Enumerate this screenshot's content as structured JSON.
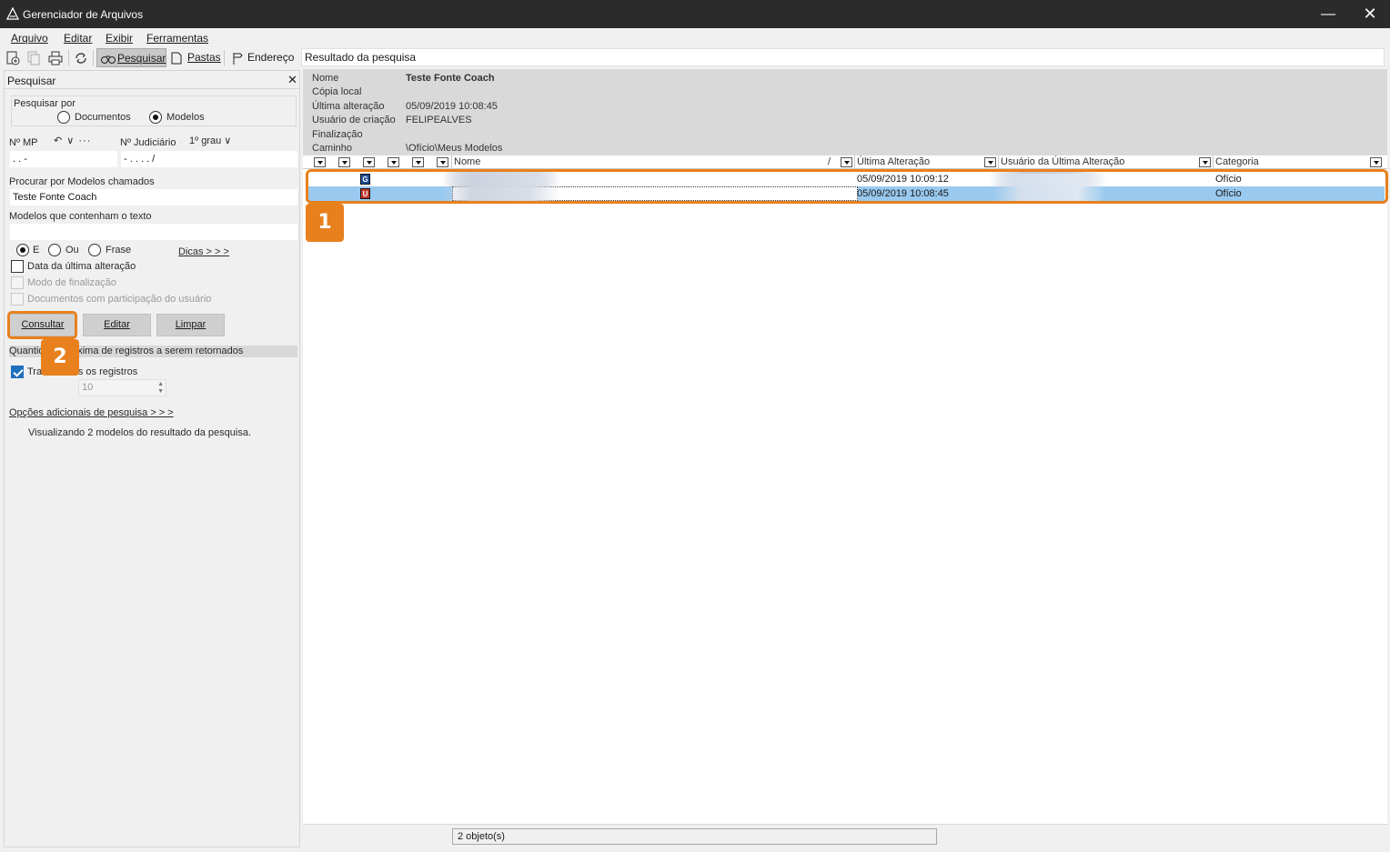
{
  "window": {
    "title": "Gerenciador de Arquivos",
    "minimize_glyph": "—",
    "close_glyph": "✕"
  },
  "menu": [
    "Arquivo",
    "Editar",
    "Exibir",
    "Ferramentas"
  ],
  "toolbar": {
    "search_label": "Pesquisar",
    "folders_label": "Pastas",
    "address_label": "Endereço",
    "address_value": "Resultado da pesquisa"
  },
  "search_panel": {
    "title": "Pesquisar",
    "close_glyph": "✕",
    "search_by_label": "Pesquisar por",
    "option_documents": "Documentos",
    "option_models": "Modelos",
    "selected_option": "Modelos",
    "mp_label": "Nº MP",
    "mp_extra": "↶ ∨ ···",
    "mp_value": ".    .           -",
    "judicial_label": "Nº Judiciário",
    "degree_value": "1º grau ∨",
    "judicial_value": "-  .     .  .  .     /",
    "models_named_label": "Procurar por Modelos chamados",
    "models_named_value": "Teste Fonte Coach",
    "models_text_label": "Modelos que contenham o texto",
    "models_text_value": "",
    "logic_and": "E",
    "logic_or": "Ou",
    "logic_phrase": "Frase",
    "tips_link": "Dicas > > >",
    "last_change_label": "Data da última alteração",
    "finalization_label": "Modo de finalização",
    "participation_label": "Documentos com participação do usuário",
    "consult_button": "Consultar",
    "edit_button": "Editar",
    "clear_button": "Limpar",
    "max_records_label": "Quantidade máxima de registros a serem retornados",
    "all_records_label": "Trazer todos os registros",
    "all_records_checked": true,
    "max_records_value": "10",
    "more_options_link": "Opções adicionais de pesquisa > > >",
    "result_summary": "Visualizando 2 modelos do resultado da pesquisa."
  },
  "details": {
    "name_label": "Nome",
    "name_value": "Teste Fonte Coach",
    "local_copy_label": "Cópia local",
    "last_change_label": "Última alteração",
    "last_change_value": "05/09/2019 10:08:45",
    "creator_label": "Usuário de criação",
    "creator_value": "FELIPEALVES",
    "finalization_label": "Finalização",
    "path_label": "Caminho",
    "path_value": "\\Ofício\\Meus Modelos"
  },
  "grid": {
    "columns": {
      "name": "Nome",
      "sort_marker": "/",
      "last_change": "Última Alteração",
      "last_change_user": "Usuário da Última Alteração",
      "category": "Categoria"
    },
    "rows": [
      {
        "badge": "G",
        "badge_color": "#1f4e99",
        "last_change": "05/09/2019 10:09:12",
        "category": "Ofício",
        "selected": false
      },
      {
        "badge": "U",
        "badge_color": "#c0392b",
        "last_change": "05/09/2019 10:08:45",
        "category": "Ofício",
        "selected": true
      }
    ]
  },
  "status": {
    "objects": "2 objeto(s)"
  },
  "callouts": [
    "1",
    "2"
  ],
  "colors": {
    "accent_orange": "#e8801d",
    "selection_blue": "#99c9ef",
    "titlebar": "#2b2b2b"
  }
}
